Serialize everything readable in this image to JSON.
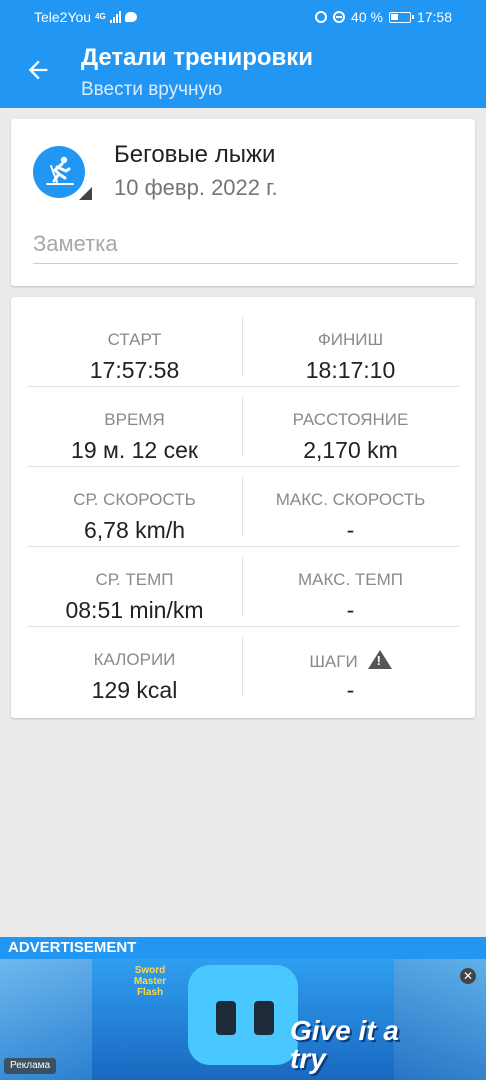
{
  "status_bar": {
    "carrier": "Tele2You",
    "network": "4G",
    "battery": "40 %",
    "time": "17:58"
  },
  "app_bar": {
    "title": "Детали тренировки",
    "subtitle": "Ввести вручную"
  },
  "workout": {
    "activity": "Беговые лыжи",
    "date": "10 февр. 2022 г.",
    "note_placeholder": "Заметка"
  },
  "stats": [
    {
      "left_label": "СТАРТ",
      "left_value": "17:57:58",
      "right_label": "ФИНИШ",
      "right_value": "18:17:10"
    },
    {
      "left_label": "ВРЕМЯ",
      "left_value": "19 м. 12 сек",
      "right_label": "РАССТОЯНИЕ",
      "right_value": "2,170 km"
    },
    {
      "left_label": "СР. СКОРОСТЬ",
      "left_value": "6,78 km/h",
      "right_label": "МАКС. СКОРОСТЬ",
      "right_value": "-"
    },
    {
      "left_label": "СР. ТЕМП",
      "left_value": "08:51 min/km",
      "right_label": "МАКС. ТЕМП",
      "right_value": "-"
    },
    {
      "left_label": "КАЛОРИИ",
      "left_value": "129 kcal",
      "right_label": "ШАГИ",
      "right_value": "-"
    }
  ],
  "advertisement": {
    "header": "ADVERTISEMENT",
    "brand": "Sword Master Flash",
    "cta": "Give it a try",
    "label": "Реклама"
  },
  "icons": {
    "back": "arrow-left-icon",
    "activity": "cross-country-skiing-icon",
    "warning": "warning-triangle-icon",
    "close": "close-icon"
  },
  "colors": {
    "primary": "#2196f3",
    "background": "#ebebeb"
  }
}
